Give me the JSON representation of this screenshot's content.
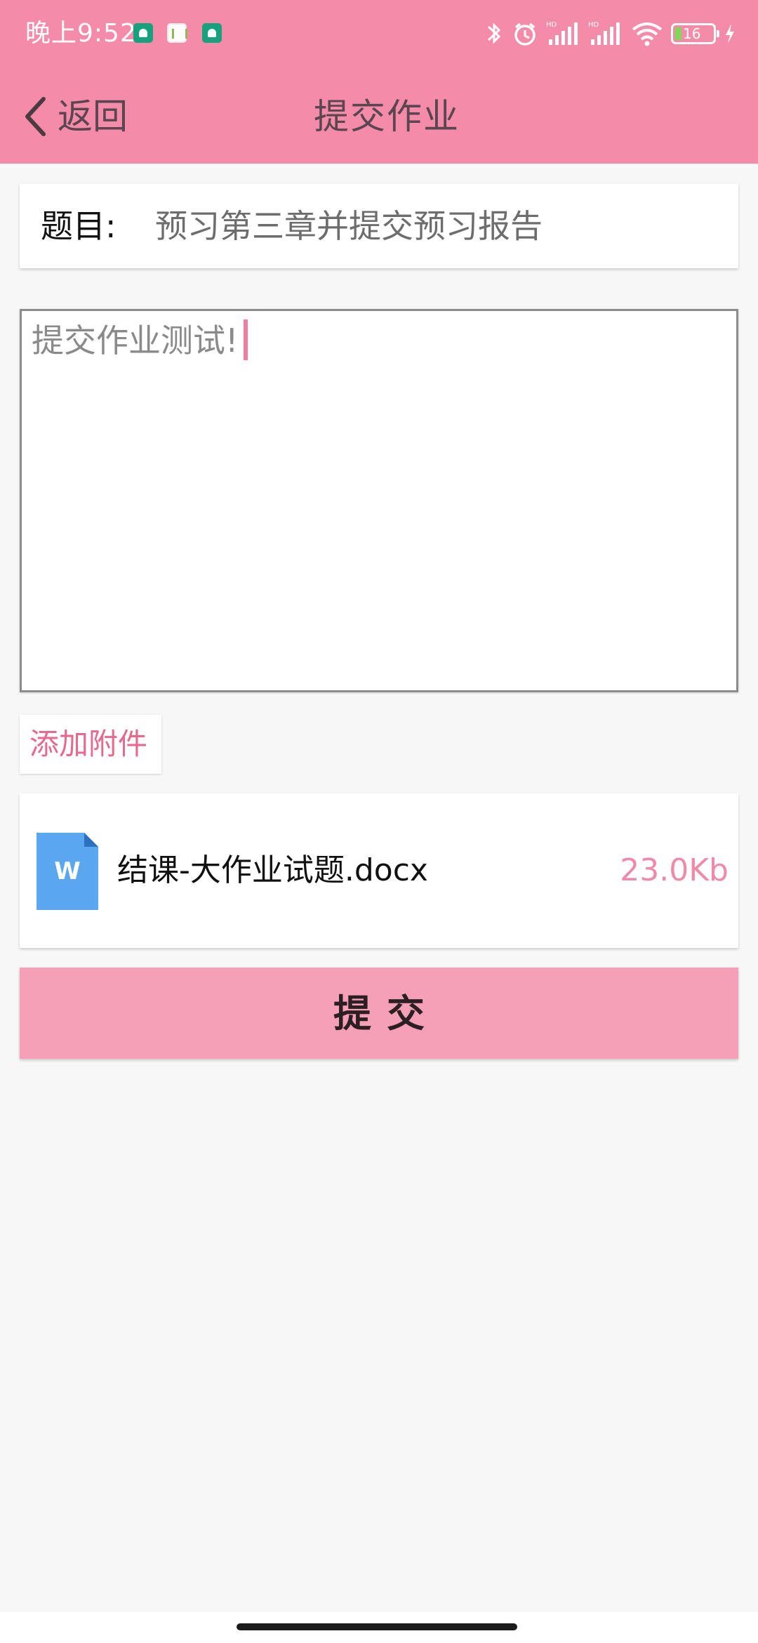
{
  "status_bar": {
    "time": "晚上9:52",
    "battery_level": "16",
    "notification_icons": [
      "android-app-icon",
      "chart-app-icon",
      "android-app-icon"
    ],
    "system_icons": [
      "bluetooth-icon",
      "alarm-icon",
      "signal-hd-icon",
      "signal-hd-icon",
      "wifi-icon",
      "battery-icon",
      "charging-icon"
    ]
  },
  "header": {
    "back_label": "返回",
    "title": "提交作业"
  },
  "topic": {
    "label": "题目:",
    "value": "预习第三章并提交预习报告"
  },
  "content": {
    "text": "提交作业测试!"
  },
  "attachment": {
    "add_label": "添加附件",
    "file_name": "结课-大作业试题.docx",
    "file_size": "23.0Kb",
    "file_icon_letter": "W"
  },
  "actions": {
    "submit_label": "提交"
  },
  "colors": {
    "header_bg": "#f48ba8",
    "accent": "#e66a8e",
    "submit_bg": "#f6a0b7",
    "word_icon": "#5aa7f0"
  }
}
